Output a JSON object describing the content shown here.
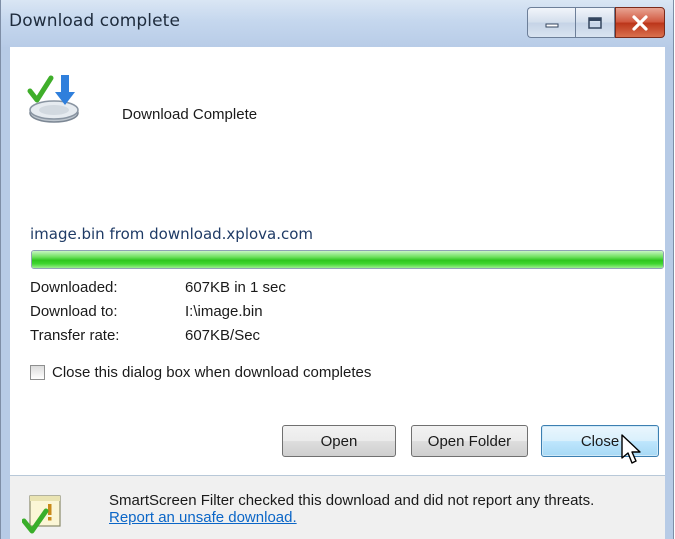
{
  "window": {
    "title": "Download complete",
    "controls": {
      "minimize": "minimize-icon",
      "maximize": "maximize-icon",
      "close": "close-icon"
    }
  },
  "header": {
    "text": "Download Complete",
    "icon": "download-complete-icon"
  },
  "download": {
    "file_line": "image.bin from download.xplova.com",
    "progress_fraction": 1.0,
    "details": [
      {
        "label": "Downloaded:",
        "value": "607KB in 1 sec"
      },
      {
        "label": "Download to:",
        "value": "I:\\image.bin"
      },
      {
        "label": "Transfer rate:",
        "value": "607KB/Sec"
      }
    ]
  },
  "option": {
    "label": "Close this dialog box when download completes",
    "checked": false
  },
  "buttons": {
    "open": "Open",
    "open_folder": "Open Folder",
    "close": "Close"
  },
  "footer": {
    "text": "SmartScreen Filter checked this download and did not report any threats.",
    "link": "Report an unsafe download.",
    "icon": "smartscreen-check-icon"
  },
  "colors": {
    "progress_green": "#2ec61e",
    "link_blue": "#0b66c7",
    "close_button_red": "#c9452a"
  }
}
